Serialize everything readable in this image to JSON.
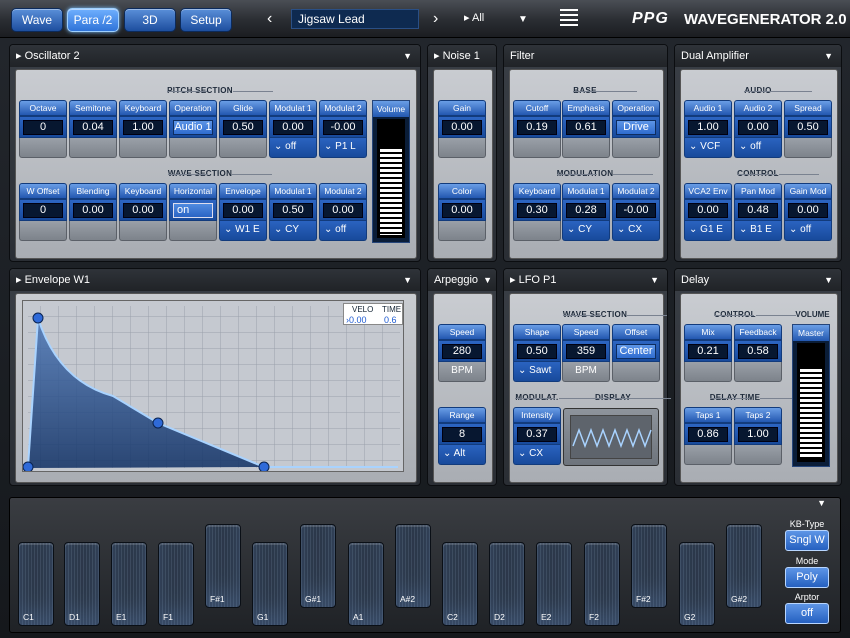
{
  "topbar": {
    "tabs": [
      "Wave",
      "Para /2",
      "3D",
      "Setup"
    ],
    "active_tab": "Para /2",
    "preset": "Jigsaw Lead",
    "filter": "All",
    "logo": "PPG",
    "product": "WAVEGENERATOR 2.0"
  },
  "osc": {
    "title": "Oscillator 2",
    "pitch_section": "PITCH SECTION",
    "wave_section": "WAVE SECTION",
    "pitch": [
      {
        "l": "Octave",
        "v": "0"
      },
      {
        "l": "Semitone",
        "v": "0.04"
      },
      {
        "l": "Keyboard",
        "v": "1.00"
      },
      {
        "l": "Operation",
        "v": "Audio 1"
      },
      {
        "l": "Glide",
        "v": "0.50"
      },
      {
        "l": "Modulat 1",
        "v": "0.00",
        "f": "off"
      },
      {
        "l": "Modulat 2",
        "v": "-0.00",
        "f": "P1 L"
      }
    ],
    "wave": [
      {
        "l": "W Offset",
        "v": "0"
      },
      {
        "l": "Blending",
        "v": "0.00"
      },
      {
        "l": "Keyboard",
        "v": "0.00"
      },
      {
        "l": "Horizontal",
        "v": "on"
      },
      {
        "l": "Envelope",
        "v": "0.00",
        "f": "W1 E"
      },
      {
        "l": "Modulat 1",
        "v": "0.50",
        "f": "CY"
      },
      {
        "l": "Modulat 2",
        "v": "0.00",
        "f": "off"
      }
    ],
    "volume_label": "Volume",
    "volume_level": 0.78
  },
  "noise": {
    "title": "Noise 1",
    "gain_l": "Gain",
    "gain_v": "0.00",
    "color_l": "Color",
    "color_v": "0.00"
  },
  "filter": {
    "title": "Filter",
    "base": "BASE",
    "modulation": "MODULATION",
    "base_ctl": [
      {
        "l": "Cutoff",
        "v": "0.19"
      },
      {
        "l": "Emphasis",
        "v": "0.61"
      },
      {
        "l": "Operation",
        "v": "Drive"
      }
    ],
    "mod_ctl": [
      {
        "l": "Keyboard",
        "v": "0.30"
      },
      {
        "l": "Modulat 1",
        "v": "0.28",
        "f": "CY"
      },
      {
        "l": "Modulat 2",
        "v": "-0.00",
        "f": "CX"
      }
    ]
  },
  "amp": {
    "title": "Dual Amplifier",
    "audio": "AUDIO",
    "control": "CONTROL",
    "audio_ctl": [
      {
        "l": "Audio 1",
        "v": "1.00",
        "f": "VCF"
      },
      {
        "l": "Audio 2",
        "v": "0.00",
        "f": "off"
      },
      {
        "l": "Spread",
        "v": "0.50"
      }
    ],
    "control_ctl": [
      {
        "l": "VCA2 Env",
        "v": "0.00",
        "f": "G1 E"
      },
      {
        "l": "Pan Mod",
        "v": "0.48",
        "f": "B1 E"
      },
      {
        "l": "Gain Mod",
        "v": "0.00",
        "f": "off"
      }
    ]
  },
  "env": {
    "title": "Envelope W1",
    "velo_l": "VELO",
    "velo_v": "0.00",
    "time_l": "TIME",
    "time_v": "0.6"
  },
  "arp": {
    "title": "Arpeggio",
    "speed_l": "Speed",
    "speed_v": "280",
    "speed_f": "BPM",
    "range_l": "Range",
    "range_v": "8",
    "range_f": "Alt"
  },
  "lfo": {
    "title": "LFO P1",
    "wave_section": "WAVE SECTION",
    "modulat": "MODULAT.",
    "display": "DISPLAY",
    "shape_l": "Shape",
    "shape_v": "0.50",
    "shape_f": "Sawt",
    "speed_l": "Speed",
    "speed_v": "359",
    "speed_f": "BPM",
    "offset_l": "Offset",
    "offset_v": "Center",
    "int_l": "Intensity",
    "int_v": "0.37",
    "int_f": "CX"
  },
  "delay": {
    "title": "Delay",
    "control": "CONTROL",
    "volume": "VOLUME",
    "delay_time": "DELAY TIME",
    "mix_l": "Mix",
    "mix_v": "0.21",
    "fb_l": "Feedback",
    "fb_v": "0.58",
    "t1_l": "Taps 1",
    "t1_v": "0.86",
    "t2_l": "Taps 2",
    "t2_v": "1.00",
    "master_l": "Master",
    "master_level": 0.82
  },
  "keyboard": {
    "white": [
      "C1",
      "D1",
      "E1",
      "F1",
      "G1",
      "A1",
      "C2",
      "D2",
      "E2",
      "F2",
      "G2"
    ],
    "black": [
      "F#1",
      "G#1",
      "A#2",
      "F#2",
      "G#2"
    ],
    "kbtype_l": "KB-Type",
    "kbtype_v": "Sngl W",
    "mode_l": "Mode",
    "mode_v": "Poly",
    "arptor_l": "Arptor",
    "arptor_v": "off"
  }
}
